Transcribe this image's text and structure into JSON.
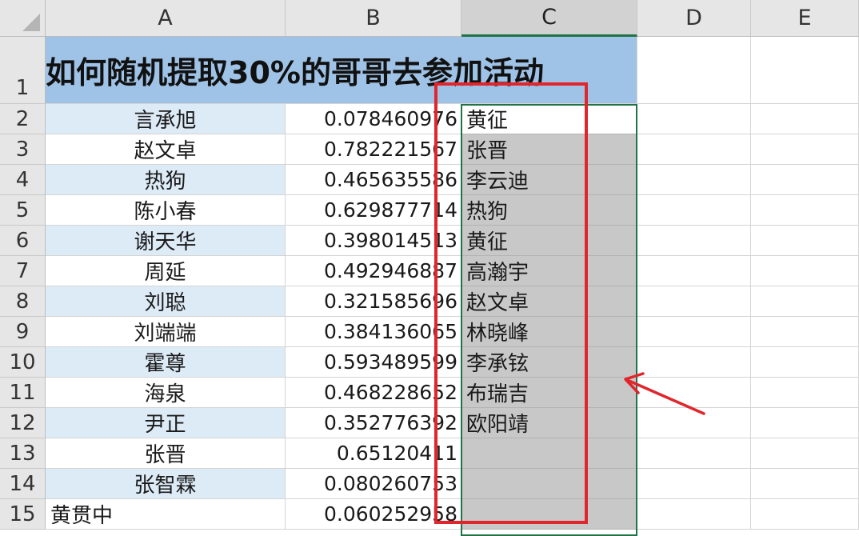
{
  "columns": [
    "A",
    "B",
    "C",
    "D",
    "E"
  ],
  "selected_column": "C",
  "row_numbers": [
    "1",
    "2",
    "3",
    "4",
    "5",
    "6",
    "7",
    "8",
    "9",
    "10",
    "11",
    "12",
    "13",
    "14",
    "15"
  ],
  "title": "如何随机提取30%的哥哥去参加活动",
  "rows": [
    {
      "name": "言承旭",
      "value": "0.078460976",
      "result": "黄征"
    },
    {
      "name": "赵文卓",
      "value": "0.782221567",
      "result": "张晋"
    },
    {
      "name": "热狗",
      "value": "0.465635586",
      "result": "李云迪"
    },
    {
      "name": "陈小春",
      "value": "0.629877714",
      "result": "热狗"
    },
    {
      "name": "谢天华",
      "value": "0.398014513",
      "result": "黄征"
    },
    {
      "name": "周延",
      "value": "0.492946887",
      "result": "高瀚宇"
    },
    {
      "name": "刘聪",
      "value": "0.321585696",
      "result": "赵文卓"
    },
    {
      "name": "刘端端",
      "value": "0.384136065",
      "result": "林晓峰"
    },
    {
      "name": "霍尊",
      "value": "0.593489599",
      "result": "李承铉"
    },
    {
      "name": "海泉",
      "value": "0.468228652",
      "result": "布瑞吉"
    },
    {
      "name": "尹正",
      "value": "0.352776392",
      "result": "欧阳靖"
    },
    {
      "name": "张晋",
      "value": "0.65120411",
      "result": ""
    },
    {
      "name": "张智霖",
      "value": "0.080260753",
      "result": ""
    },
    {
      "name": "黄贯中",
      "value": "0.060252958",
      "result": ""
    }
  ],
  "colors": {
    "title_fill": "#9fc3e7",
    "band_fill": "#ddebf7",
    "selection_fill": "#c8c8c8",
    "selection_border": "#217346",
    "annotation_red": "#e0262c"
  },
  "icons": {
    "annotation": "red-arrow-icon"
  }
}
